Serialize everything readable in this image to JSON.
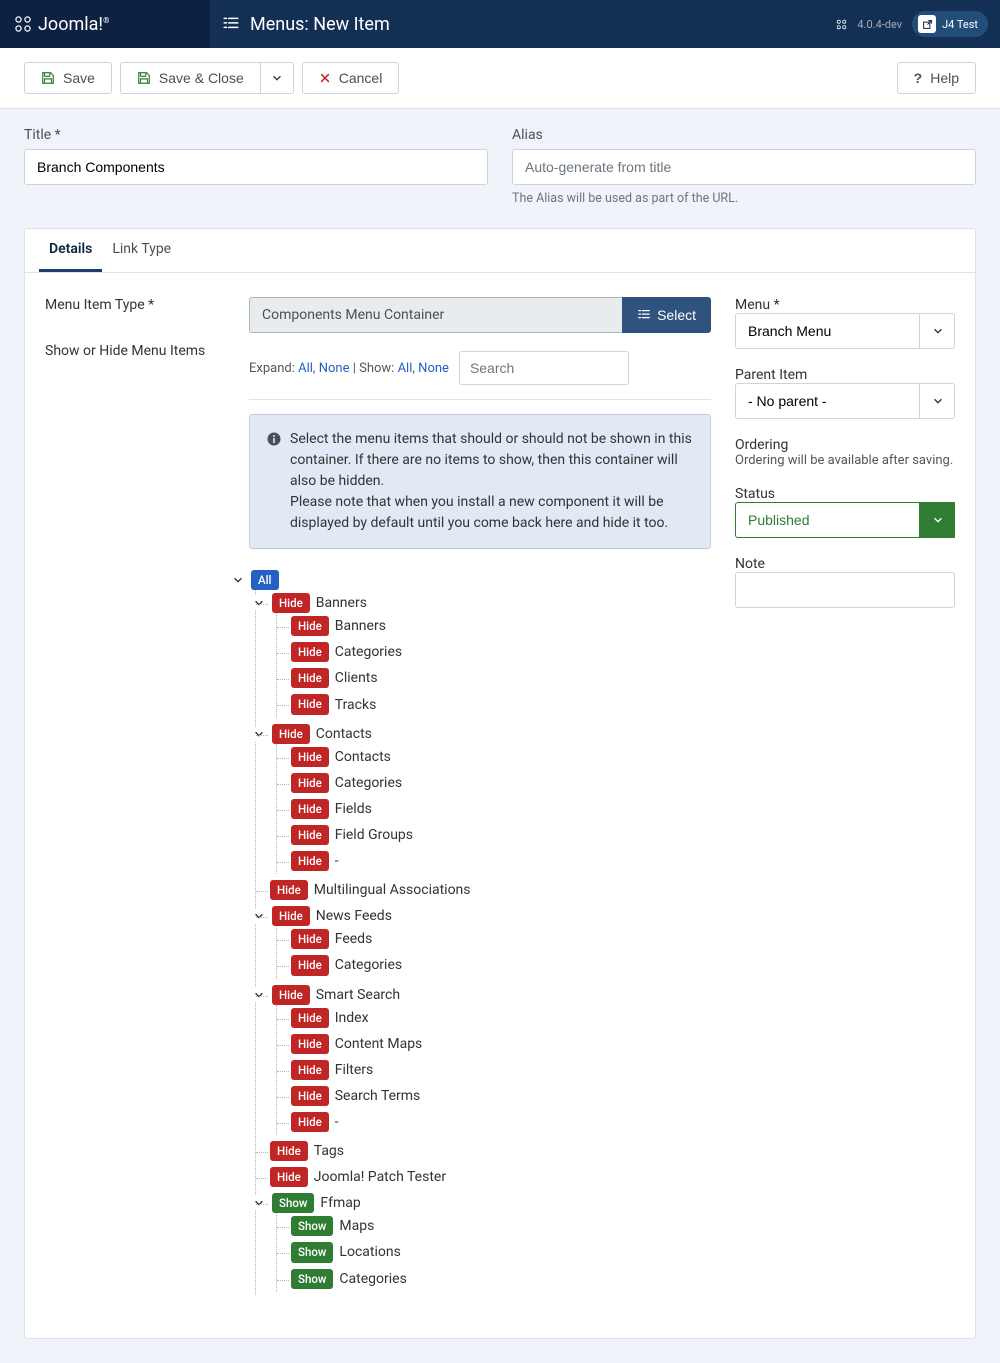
{
  "header": {
    "brand": "Joomla!",
    "title": "Menus: New Item",
    "version": "4.0.4-dev",
    "siteName": "J4 Test"
  },
  "toolbar": {
    "save": "Save",
    "saveClose": "Save & Close",
    "cancel": "Cancel",
    "help": "Help"
  },
  "titleRow": {
    "titleLabel": "Title",
    "titleValue": "Branch Components",
    "aliasLabel": "Alias",
    "aliasPlaceholder": "Auto-generate from title",
    "aliasHint": "The Alias will be used as part of the URL."
  },
  "tabs": {
    "details": "Details",
    "linkType": "Link Type"
  },
  "labels": {
    "menuItemType": "Menu Item Type",
    "showHide": "Show or Hide Menu Items"
  },
  "typeSelect": {
    "value": "Components Menu Container",
    "button": "Select"
  },
  "controls": {
    "expand": "Expand:",
    "show": "Show:",
    "all": "All",
    "none": "None",
    "searchPlaceholder": "Search"
  },
  "info": "Select the menu items that should or should not be shown in this container. If there are no items to show, then this container will also be hidden.\nPlease note that when you install a new component it will be displayed by default until you come back here and hide it too.",
  "sidebar": {
    "menuLabel": "Menu",
    "menuValue": "Branch Menu",
    "parentLabel": "Parent Item",
    "parentValue": "- No parent -",
    "orderingLabel": "Ordering",
    "orderingText": "Ordering will be available after saving.",
    "statusLabel": "Status",
    "statusValue": "Published",
    "noteLabel": "Note"
  },
  "badges": {
    "all": "All",
    "hide": "Hide",
    "show": "Show"
  },
  "tree": [
    {
      "state": "hide",
      "label": "Banners",
      "expandable": true,
      "children": [
        {
          "state": "hide",
          "label": "Banners"
        },
        {
          "state": "hide",
          "label": "Categories"
        },
        {
          "state": "hide",
          "label": "Clients"
        },
        {
          "state": "hide",
          "label": "Tracks"
        }
      ]
    },
    {
      "state": "hide",
      "label": "Contacts",
      "expandable": true,
      "children": [
        {
          "state": "hide",
          "label": "Contacts"
        },
        {
          "state": "hide",
          "label": "Categories"
        },
        {
          "state": "hide",
          "label": "Fields"
        },
        {
          "state": "hide",
          "label": "Field Groups"
        },
        {
          "state": "hide",
          "label": "-"
        }
      ]
    },
    {
      "state": "hide",
      "label": "Multilingual Associations"
    },
    {
      "state": "hide",
      "label": "News Feeds",
      "expandable": true,
      "children": [
        {
          "state": "hide",
          "label": "Feeds"
        },
        {
          "state": "hide",
          "label": "Categories"
        }
      ]
    },
    {
      "state": "hide",
      "label": "Smart Search",
      "expandable": true,
      "children": [
        {
          "state": "hide",
          "label": "Index"
        },
        {
          "state": "hide",
          "label": "Content Maps"
        },
        {
          "state": "hide",
          "label": "Filters"
        },
        {
          "state": "hide",
          "label": "Search Terms"
        },
        {
          "state": "hide",
          "label": "-"
        }
      ]
    },
    {
      "state": "hide",
      "label": "Tags"
    },
    {
      "state": "hide",
      "label": "Joomla! Patch Tester"
    },
    {
      "state": "show",
      "label": "Ffmap",
      "expandable": true,
      "children": [
        {
          "state": "show",
          "label": "Maps"
        },
        {
          "state": "show",
          "label": "Locations"
        },
        {
          "state": "show",
          "label": "Categories"
        }
      ]
    }
  ]
}
